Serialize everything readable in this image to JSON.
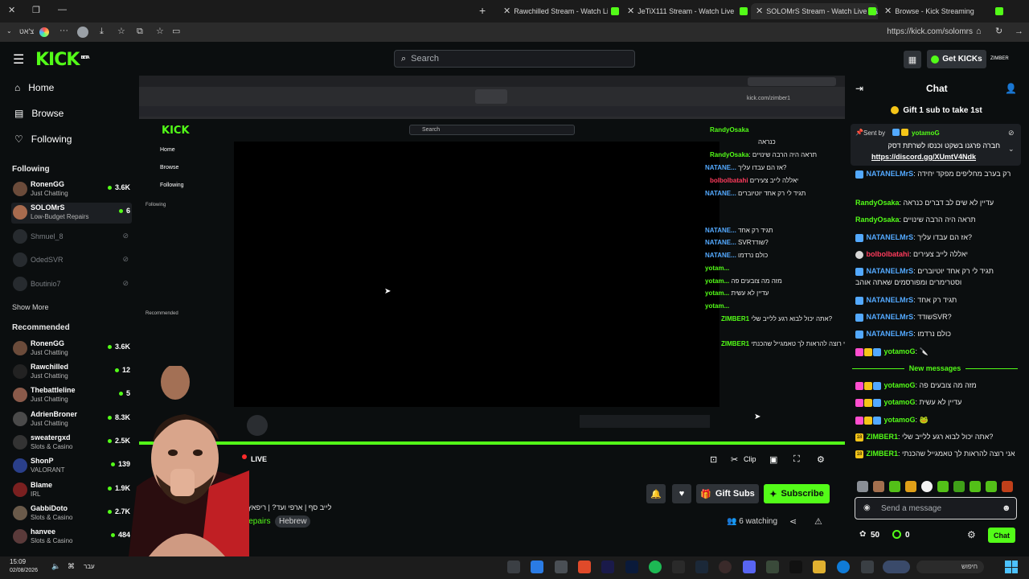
{
  "browser": {
    "tabs": [
      {
        "label": "Rawchilled Stream - Watch Live or"
      },
      {
        "label": "JeTiX111 Stream - Watch Live on K"
      },
      {
        "label": "SOLOMrS Stream - Watch Live"
      },
      {
        "label": "Browse - Kick Streaming"
      }
    ],
    "url": "https://kick.com/solomrs",
    "left_label": "צ'אט"
  },
  "kick": {
    "logo": "KICK",
    "logo_beta": "BETA",
    "search_placeholder": "Search",
    "get_kicks": "Get KICKs",
    "user_tag": "ZIMBER"
  },
  "sidebar": {
    "nav": [
      {
        "label": "Home"
      },
      {
        "label": "Browse"
      },
      {
        "label": "Following"
      }
    ],
    "following_title": "Following",
    "following": [
      {
        "name": "RonenGG",
        "category": "Just Chatting",
        "viewers": "3.6K"
      },
      {
        "name": "SOLOMrS",
        "category": "Low-Budget Repairs",
        "viewers": "6"
      },
      {
        "name": "Shmuel_8",
        "category": "",
        "viewers": ""
      },
      {
        "name": "OdedSVR",
        "category": "",
        "viewers": ""
      },
      {
        "name": "Boutinio7",
        "category": "",
        "viewers": ""
      }
    ],
    "show_more": "Show More",
    "recommended_title": "Recommended",
    "recommended": [
      {
        "name": "RonenGG",
        "category": "Just Chatting",
        "viewers": "3.6K"
      },
      {
        "name": "Rawchilled",
        "category": "Just Chatting",
        "viewers": "12"
      },
      {
        "name": "Thebattleline",
        "category": "Just Chatting",
        "viewers": "5"
      },
      {
        "name": "AdrienBroner",
        "category": "Just Chatting",
        "viewers": "8.3K"
      },
      {
        "name": "sweatergxd",
        "category": "Slots & Casino",
        "viewers": "2.5K"
      },
      {
        "name": "ShonP",
        "category": "VALORANT",
        "viewers": "139"
      },
      {
        "name": "Blame",
        "category": "IRL",
        "viewers": "1.9K"
      },
      {
        "name": "GabbiDoto",
        "category": "Slots & Casino",
        "viewers": "2.7K"
      },
      {
        "name": "hanvee",
        "category": "Slots & Casino",
        "viewers": "484"
      }
    ]
  },
  "video": {
    "inner": {
      "url": "kick.com/zimber1",
      "search": "Search",
      "nav": [
        "Home",
        "Browse",
        "Following"
      ],
      "following_title": "Following",
      "recommended_title": "Recommended",
      "chat": [
        {
          "user": "RandyOsaka",
          "text": "כנראה"
        },
        {
          "user": "RandyOsaka",
          "text": "תראה היה הרבה שינויים"
        },
        {
          "user": "NATANE...",
          "text": "אז הם עבדו עליך?"
        },
        {
          "user": "bolbolbatahi",
          "text": "יאללה לייב צעירים"
        },
        {
          "user": "NATANE...",
          "text": "תגיד לי רק אחד יוטיוברים"
        },
        {
          "user": "NATANE...",
          "text": "תגיד רק אחד"
        },
        {
          "user": "NATANE...",
          "text": "SVRשודד?"
        },
        {
          "user": "NATANE...",
          "text": "כולם נרדמו"
        },
        {
          "user": "yotam...",
          "text": ""
        },
        {
          "user": "yotam...",
          "text": "מזה מה צובעים פה"
        },
        {
          "user": "yotam...",
          "text": "עדיין לא עשית"
        },
        {
          "user": "yotam...",
          "text": ""
        },
        {
          "user": "ZIMBER1",
          "text": "אתה יכול לבוא רגע ללייב שלי?"
        },
        {
          "user": "ZIMBER1",
          "text": "אני רוצה להראות לך טאמגייל שהכנתי"
        }
      ]
    },
    "live_label": "LIVE",
    "clip_label": "Clip"
  },
  "stream": {
    "name_fragment": "rS",
    "title": "לייב סף | ארפי ועד? | ריפאץ את",
    "category": "Repairs",
    "tag": "Hebrew",
    "gift_subs": "Gift Subs",
    "subscribe": "Subscribe",
    "watching": "6 watching"
  },
  "chat": {
    "title": "Chat",
    "gift_banner": "Gift 1 sub to take 1st",
    "pinned_sent_by": "Sent by",
    "pinned_user": "yotamoG",
    "pinned_text": "חברה פרגנו בשקט וכנסו לשרתת דסק",
    "pinned_link": "https://discord.gg/XUmtV4Ndk",
    "messages": [
      {
        "user": "NATANELMrS",
        "text": "רק בערב מחליפים מפקד יחידה",
        "color": "#53a9ff"
      },
      {
        "user": "RandyOsaka",
        "text": "עדיין לא שים לב דברים כנראה",
        "color": "#53fc18"
      },
      {
        "user": "RandyOsaka",
        "text": "תראה היה הרבה שינויים",
        "color": "#53fc18"
      },
      {
        "user": "NATANELMrS",
        "text": "אז הם עבדו עליך?",
        "color": "#53a9ff"
      },
      {
        "user": "bolbolbatahi",
        "text": "יאללה לייב צעירים",
        "color": "#ff3b5c"
      },
      {
        "user": "NATANELMrS",
        "text": "תגיד לי רק אחד יוטיוברים וסטרימרים ומפורסמים שאתה אוהב",
        "color": "#53a9ff"
      },
      {
        "user": "NATANELMrS",
        "text": "תגיד רק אחד",
        "color": "#53a9ff"
      },
      {
        "user": "NATANELMrS",
        "text": "שודדSVR?",
        "color": "#53a9ff"
      },
      {
        "user": "NATANELMrS",
        "text": "כולם נרדמו",
        "color": "#53a9ff"
      },
      {
        "user": "yotamoG",
        "text": "",
        "color": "#53fc18"
      }
    ],
    "new_messages": "New messages",
    "new": [
      {
        "user": "yotamoG",
        "text": "מזה מה צובעים פה",
        "color": "#53fc18"
      },
      {
        "user": "yotamoG",
        "text": "עדיין לא עשית",
        "color": "#53fc18"
      },
      {
        "user": "yotamoG",
        "text": "",
        "color": "#53fc18"
      },
      {
        "user": "ZIMBER1",
        "text": "אתה יכול לבוא רגע ללייב שלי?",
        "color": "#53fc18"
      },
      {
        "user": "ZIMBER1",
        "text": "אני רוצה להראות לך טאמגייל שהכנתי",
        "color": "#53fc18"
      }
    ],
    "badge_18": "18",
    "input_placeholder": "Send a message",
    "points": "50",
    "kicks": "0",
    "send_label": "Chat"
  },
  "taskbar": {
    "time": "15:09",
    "date": "02/08/2026",
    "search_label": "חיפוש",
    "lang": "עבר"
  }
}
